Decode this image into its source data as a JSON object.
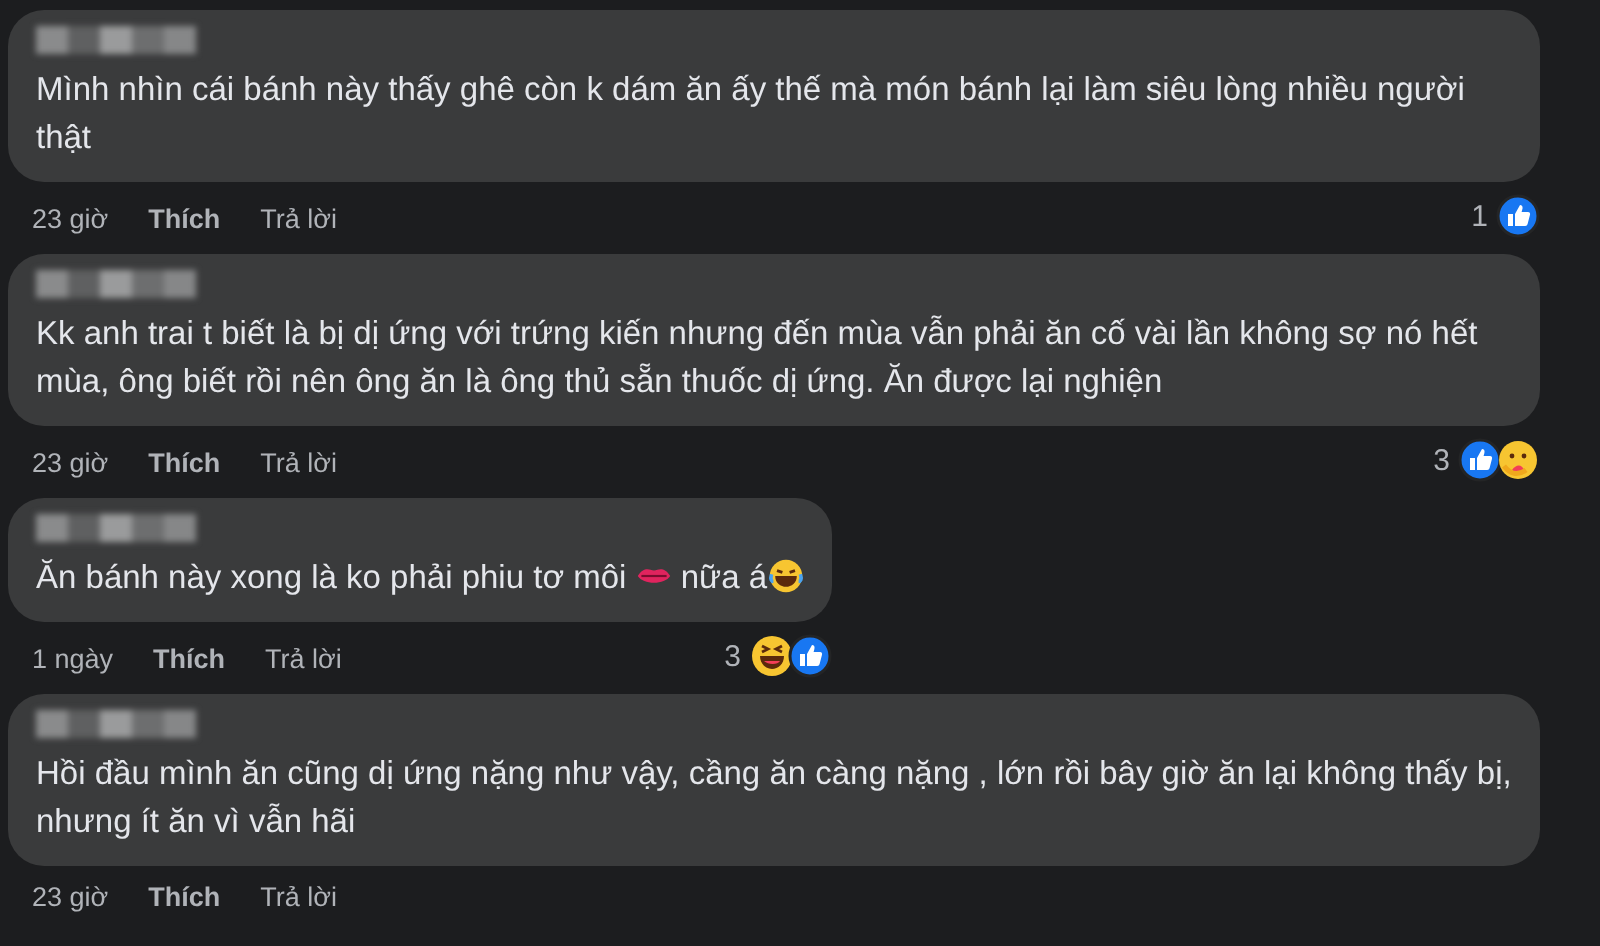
{
  "comments": [
    {
      "body": [
        {
          "kind": "text",
          "text": "Mình nhìn cái bánh này thấy ghê còn k dám ăn ấy thế mà món bánh lại làm siêu lòng nhiều người thật"
        }
      ],
      "time": "23 giờ",
      "like_label": "Thích",
      "reply_label": "Trả lời",
      "reaction_count": "1",
      "reactions": [
        {
          "kind": "like"
        }
      ]
    },
    {
      "body": [
        {
          "kind": "text",
          "text": "Kk anh trai t biết là bị dị ứng với trứng kiến nhưng đến mùa vẫn phải ăn cố vài lần không sợ nó hết mùa, ông biết rồi nên ông ăn là ông thủ sẵn thuốc dị ứng. Ăn được lại nghiện"
        }
      ],
      "time": "23 giờ",
      "like_label": "Thích",
      "reply_label": "Trả lời",
      "reaction_count": "3",
      "reactions": [
        {
          "kind": "like"
        },
        {
          "kind": "care"
        }
      ]
    },
    {
      "body": [
        {
          "kind": "text",
          "text": "Ăn bánh này xong là ko phải phiu tơ môi "
        },
        {
          "kind": "lips"
        },
        {
          "kind": "text",
          "text": " nữa á"
        },
        {
          "kind": "laugh"
        }
      ],
      "time": "1 ngày",
      "like_label": "Thích",
      "reply_label": "Trả lời",
      "reaction_count": "3",
      "reactions": [
        {
          "kind": "haha"
        },
        {
          "kind": "like"
        }
      ]
    },
    {
      "body": [
        {
          "kind": "text",
          "text": "Hồi đầu mình ăn cũng dị ứng nặng như vậy, cầng ăn càng nặng , lớn rồi bây giờ ăn lại không thấy bị, nhưng ít ăn vì vẫn hãi"
        }
      ],
      "time": "23 giờ",
      "like_label": "Thích",
      "reply_label": "Trả lời"
    }
  ]
}
